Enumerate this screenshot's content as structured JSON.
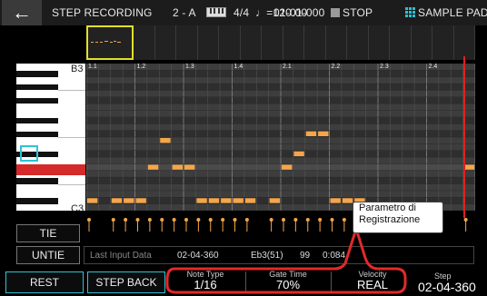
{
  "header": {
    "title": "STEP RECORDING",
    "track": "2 - A",
    "time_signature": "4/4",
    "tempo": "♩=120.00",
    "position": "01-01-000",
    "transport": "STOP",
    "pad_mode": "SAMPLE PAD"
  },
  "grid": {
    "beat_labels": [
      "1.1",
      "1.2",
      "1.3",
      "1.4",
      "2.1",
      "2.2",
      "2.3",
      "2.4"
    ],
    "key_labels": [
      "B3",
      "C3"
    ],
    "notes": [
      {
        "step": 0,
        "row": 20
      },
      {
        "step": 2,
        "row": 20
      },
      {
        "step": 3,
        "row": 20
      },
      {
        "step": 4,
        "row": 20
      },
      {
        "step": 5,
        "row": 15
      },
      {
        "step": 6,
        "row": 11
      },
      {
        "step": 7,
        "row": 15
      },
      {
        "step": 8,
        "row": 15
      },
      {
        "step": 9,
        "row": 20
      },
      {
        "step": 10,
        "row": 20
      },
      {
        "step": 11,
        "row": 20
      },
      {
        "step": 12,
        "row": 20
      },
      {
        "step": 13,
        "row": 20
      },
      {
        "step": 15,
        "row": 20
      },
      {
        "step": 16,
        "row": 15
      },
      {
        "step": 17,
        "row": 13
      },
      {
        "step": 18,
        "row": 10
      },
      {
        "step": 19,
        "row": 10
      },
      {
        "step": 20,
        "row": 20
      },
      {
        "step": 21,
        "row": 20
      },
      {
        "step": 22,
        "row": 20
      },
      {
        "step": 31,
        "row": 15
      }
    ]
  },
  "buttons": {
    "tie": "TIE",
    "untie": "UNTIE",
    "rest": "REST",
    "step_back": "STEP BACK"
  },
  "last_input": {
    "label": "Last Input Data",
    "position": "02-04-360",
    "note": "Eb3(51)",
    "velocity": "99",
    "gate": "0:084"
  },
  "params": {
    "note_type_label": "Note Type",
    "note_type_value": "1/16",
    "gate_time_label": "Gate Time",
    "gate_time_value": "70%",
    "velocity_label": "Velocity",
    "velocity_value": "REAL",
    "step_label": "Step",
    "step_value": "02-04-360"
  },
  "callout": {
    "line1": "Parametro di",
    "line2": "Registrazione"
  },
  "colors": {
    "note": "#f5a54a",
    "accent_cyan": "#2ec4d5",
    "playhead": "#e02020",
    "highlight_box": "#e02a2a",
    "overview_select": "#e0e02a"
  },
  "icons": [
    "back-arrow-icon",
    "keyboard-icon",
    "quarter-note-icon",
    "stop-icon",
    "pad-grid-icon"
  ]
}
